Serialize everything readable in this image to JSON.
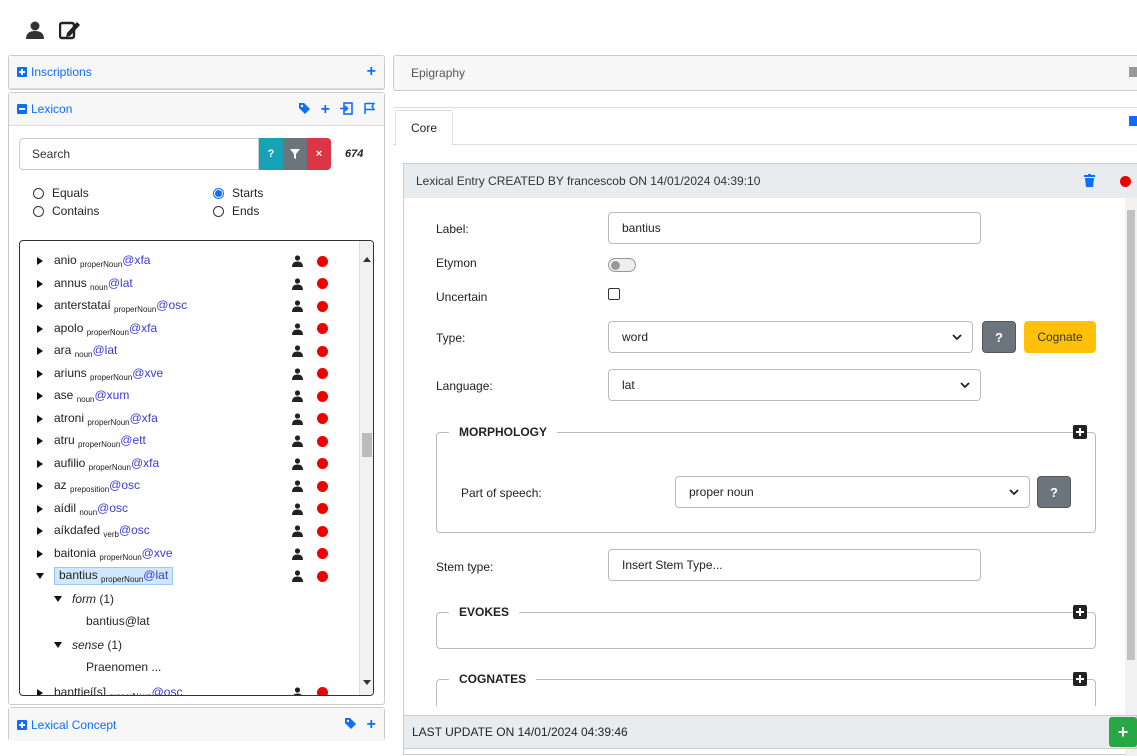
{
  "top_toolbar": {
    "icons": [
      "user-icon",
      "edit-icon"
    ]
  },
  "inscriptions": {
    "label": "Inscriptions"
  },
  "lexicon": {
    "label": "Lexicon",
    "search_placeholder": "Search",
    "count": "674",
    "buttons": {
      "help": "?",
      "clear": "×"
    },
    "radios": [
      {
        "label": "Equals",
        "checked": false
      },
      {
        "label": "Starts",
        "checked": true
      },
      {
        "label": "Contains",
        "checked": false
      },
      {
        "label": "Ends",
        "checked": false
      }
    ],
    "entries": [
      {
        "name": "anio",
        "pos": "properNoun",
        "lang": "@xfa"
      },
      {
        "name": "annus",
        "pos": "noun",
        "lang": "@lat"
      },
      {
        "name": "anterstataí",
        "pos": "properNoun",
        "lang": "@osc"
      },
      {
        "name": "apolo",
        "pos": "properNoun",
        "lang": "@xfa"
      },
      {
        "name": "ara",
        "pos": "noun",
        "lang": "@lat"
      },
      {
        "name": "ariuns",
        "pos": "properNoun",
        "lang": "@xve"
      },
      {
        "name": "ase",
        "pos": "noun",
        "lang": "@xum"
      },
      {
        "name": "atroni",
        "pos": "properNoun",
        "lang": "@xfa"
      },
      {
        "name": "atru",
        "pos": "properNoun",
        "lang": "@ett"
      },
      {
        "name": "aufilio",
        "pos": "properNoun",
        "lang": "@xfa"
      },
      {
        "name": "az",
        "pos": "preposition",
        "lang": "@osc"
      },
      {
        "name": "aídil",
        "pos": "noun",
        "lang": "@osc"
      },
      {
        "name": "aíkdafed",
        "pos": "verb",
        "lang": "@osc"
      },
      {
        "name": "baitonia",
        "pos": "properNoun",
        "lang": "@xve"
      },
      {
        "name": "bantius",
        "pos": "properNoun",
        "lang": "@lat"
      }
    ],
    "expanded": {
      "form_label": "form",
      "form_count": "(1)",
      "form_value": "bantius@lat",
      "sense_label": "sense",
      "sense_count": "(1)",
      "sense_value": "Praenomen ..."
    },
    "last_entry": {
      "name": "banttieí[s]",
      "pos": "properNoun",
      "lang": "@osc"
    }
  },
  "lexical_concept": {
    "label": "Lexical Concept"
  },
  "epigraphy": {
    "label": "Epigraphy"
  },
  "tabs": [
    {
      "label": "Core"
    }
  ],
  "entry": {
    "header": "Lexical Entry CREATED BY francescob ON 14/01/2024 04:39:10",
    "footer": "LAST UPDATE ON 14/01/2024 04:39:46",
    "fields": {
      "label_caption": "Label:",
      "label_value": "bantius",
      "etymon_caption": "Etymon",
      "uncertain_caption": "Uncertain",
      "type_caption": "Type:",
      "type_value": "word",
      "cognate_button": "Cognate",
      "language_caption": "Language:",
      "language_value": "lat",
      "morphology_title": "MORPHOLOGY",
      "pos_caption": "Part of speech:",
      "pos_value": "proper noun",
      "stem_caption": "Stem type:",
      "stem_placeholder": "Insert Stem Type...",
      "evokes_title": "EVOKES",
      "cognates_title": "COGNATES"
    }
  },
  "colors": {
    "accent": "#0d6efd",
    "danger": "#dc3545",
    "info": "#17a2b8",
    "warning": "#ffc107",
    "success": "#28a745"
  }
}
